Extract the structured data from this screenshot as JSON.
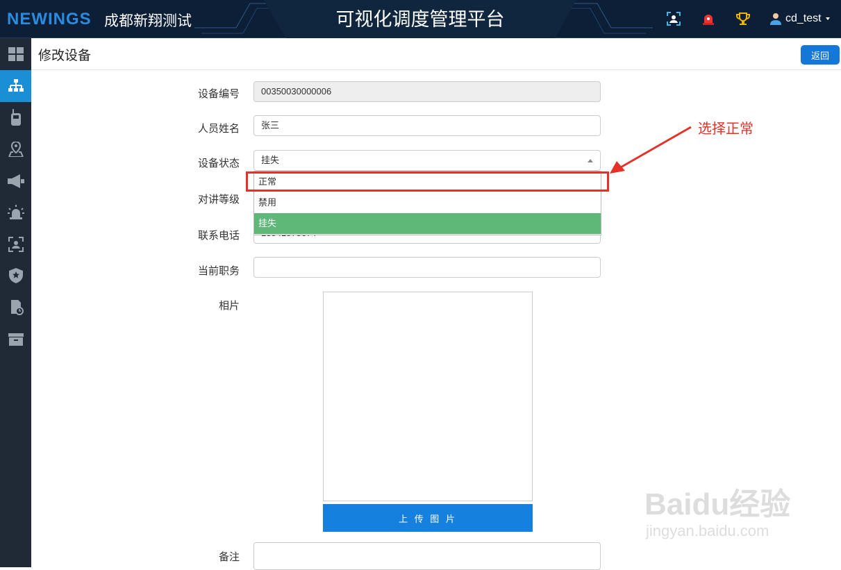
{
  "header": {
    "logo": "NEWINGS",
    "company": "成都新翔测试",
    "title": "可视化调度管理平台",
    "username": "cd_test"
  },
  "sidebar": {
    "items": [
      {
        "icon": "dashboard-icon"
      },
      {
        "icon": "org-tree-icon",
        "active": true
      },
      {
        "icon": "walkie-talkie-icon"
      },
      {
        "icon": "map-pin-icon"
      },
      {
        "icon": "megaphone-icon"
      },
      {
        "icon": "alarm-light-icon"
      },
      {
        "icon": "face-scan-icon"
      },
      {
        "icon": "shield-star-icon"
      },
      {
        "icon": "file-clock-icon"
      },
      {
        "icon": "archive-box-icon"
      }
    ]
  },
  "page": {
    "title": "修改设备",
    "back_label": "返回"
  },
  "form": {
    "device_id_label": "设备编号",
    "device_id_value": "00350030000006",
    "person_name_label": "人员姓名",
    "person_name_value": "张三",
    "device_status_label": "设备状态",
    "device_status_value": "挂失",
    "status_options": [
      "正常",
      "禁用",
      "挂失"
    ],
    "intercom_level_label": "对讲等级",
    "phone_label": "联系电话",
    "phone_value": "13541578674",
    "position_label": "当前职务",
    "position_value": "",
    "photo_label": "相片",
    "upload_label": "上 传 图 片",
    "remarks_label": "备注"
  },
  "annotation": {
    "text": "选择正常"
  },
  "watermark": {
    "brand": "Baidu经验",
    "url": "jingyan.baidu.com"
  },
  "colors": {
    "topbar": "#0d1f36",
    "sidebar": "#1f2a36",
    "active": "#1b8fd6",
    "primary_button": "#1577d8",
    "selected_option": "#5fb878",
    "annotation": "#e53228"
  }
}
